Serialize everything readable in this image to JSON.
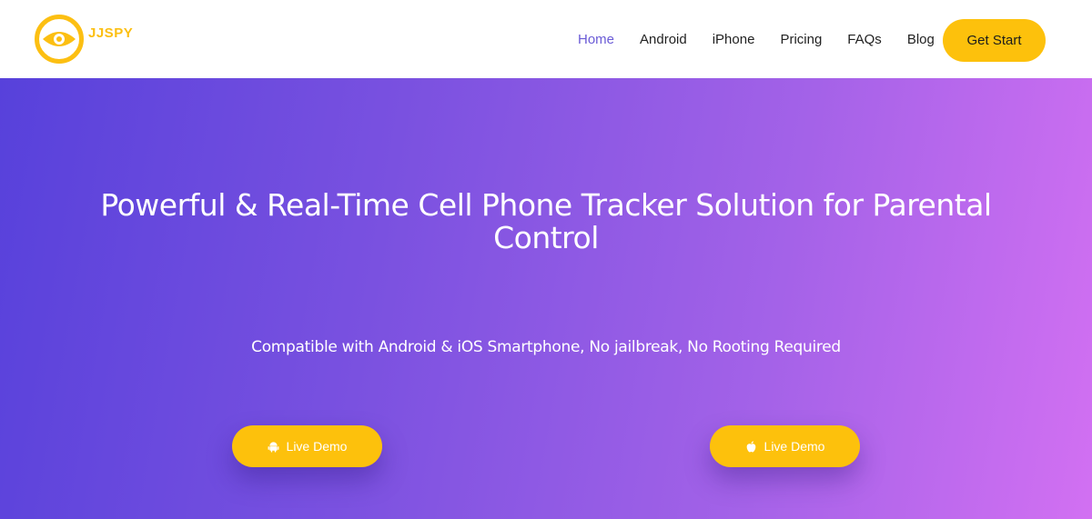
{
  "brand": {
    "name": "JJSPY",
    "logo_icon": "eye-icon",
    "accent_color": "#fcbf12"
  },
  "nav": {
    "items": [
      {
        "label": "Home",
        "active": true
      },
      {
        "label": "Android",
        "active": false
      },
      {
        "label": "iPhone",
        "active": false
      },
      {
        "label": "Pricing",
        "active": false
      },
      {
        "label": "FAQs",
        "active": false
      },
      {
        "label": "Blog",
        "active": false
      }
    ],
    "cta_label": "Get Start"
  },
  "hero": {
    "title": "Powerful & Real-Time Cell Phone Tracker Solution for Parental Control",
    "subtitle": "Compatible with Android & iOS Smartphone, No jailbreak, No Rooting Required",
    "gradient_start": "#5741db",
    "gradient_end": "#d270f2",
    "buttons": [
      {
        "label": "Live Demo",
        "icon": "android-icon"
      },
      {
        "label": "Live Demo",
        "icon": "apple-icon"
      }
    ]
  }
}
